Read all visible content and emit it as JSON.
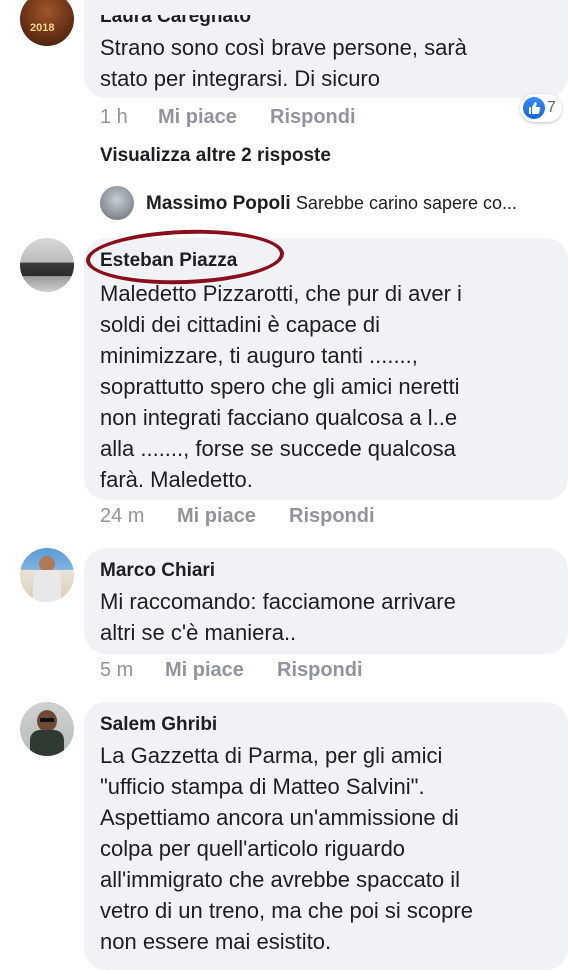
{
  "comments": [
    {
      "author": "Laura Caregnato",
      "lines": [
        "Strano sono così brave persone, sarà",
        "stato per integrarsi. Di sicuro"
      ],
      "time": "1 h",
      "like_label": "Mi piace",
      "reply_label": "Rispondi",
      "reaction_count": "7",
      "avatar_text": "2018"
    },
    {
      "author": "Esteban Piazza",
      "lines": [
        "Maledetto Pizzarotti, che pur di aver i",
        "soldi dei cittadini è capace di",
        "minimizzare,  ti auguro tanti .......,",
        "soprattutto spero  che gli amici neretti",
        "non integrati  facciano qualcosa a l..e",
        "alla ......., forse se succede qualcosa",
        "farà. Maledetto."
      ],
      "time": "24 m",
      "like_label": "Mi piace",
      "reply_label": "Rispondi"
    },
    {
      "author": "Marco Chiari",
      "lines": [
        "Mi raccomando: facciamone arrivare",
        "altri se c'è  maniera.."
      ],
      "time": "5 m",
      "like_label": "Mi piace",
      "reply_label": "Rispondi"
    },
    {
      "author": "Salem Ghribi",
      "lines": [
        "La Gazzetta di Parma, per gli amici",
        "\"ufficio stampa di Matteo Salvini\".",
        "Aspettiamo ancora un'ammissione di",
        "colpa per quell'articolo riguardo",
        "all'immigrato che avrebbe spaccato il",
        "vetro di un treno, ma che poi si scopre",
        "non essere mai esistito."
      ]
    }
  ],
  "more_replies": "Visualizza altre 2 risposte",
  "reply_preview": {
    "author": "Massimo Popoli",
    "snippet": "Sarebbe carino sapere co..."
  },
  "colors": {
    "bubble": "#f0f2f5",
    "meta": "#90949c",
    "like_blue": "#1877f2",
    "highlight": "#8b0f1a"
  },
  "icons": {
    "reaction": "thumbs-up-icon"
  }
}
